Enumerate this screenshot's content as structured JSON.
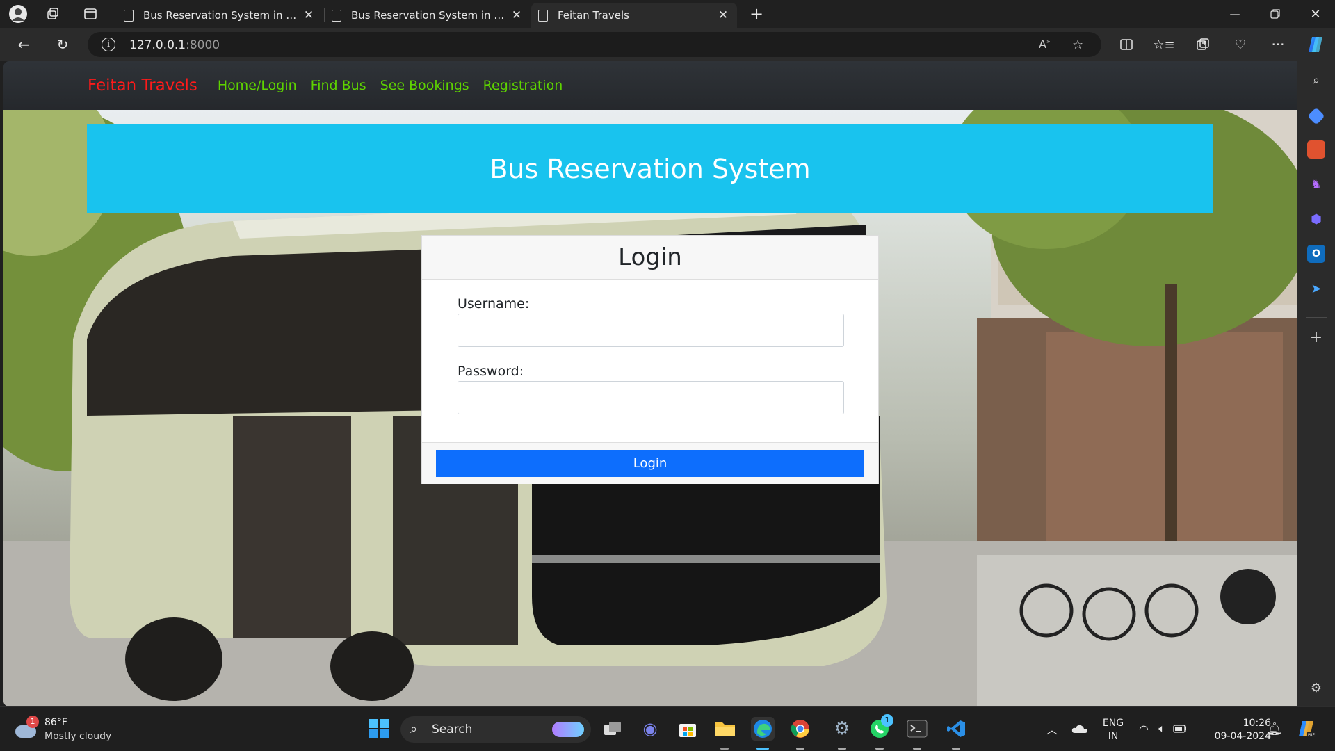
{
  "browser": {
    "tabs": [
      {
        "title": "Bus Reservation System in Djang",
        "active": false
      },
      {
        "title": "Bus Reservation System in Djang",
        "active": false
      },
      {
        "title": "Feitan Travels",
        "active": true
      }
    ],
    "new_tab_icon": "plus-icon",
    "address": {
      "host": "127.0.0.1",
      "port": ":8000"
    }
  },
  "page": {
    "brand": "Feitan Travels",
    "nav": [
      {
        "label": "Home/Login"
      },
      {
        "label": "Find Bus"
      },
      {
        "label": "See Bookings"
      },
      {
        "label": "Registration"
      }
    ],
    "hero_title": "Bus Reservation System",
    "login": {
      "title": "Login",
      "username_label": "Username:",
      "username_value": "",
      "password_label": "Password:",
      "password_value": "",
      "button_label": "Login"
    },
    "colors": {
      "brand": "#ff1a1a",
      "nav_link": "#5ed400",
      "hero": "#19c3ee",
      "button": "#0d6efd"
    }
  },
  "taskbar": {
    "weather": {
      "temp": "86°F",
      "condition": "Mostly cloudy",
      "badge": "1"
    },
    "search_label": "Search",
    "whatsapp_badge": "1",
    "language": {
      "line1": "ENG",
      "line2": "IN"
    },
    "clock": {
      "time": "10:26",
      "date": "09-04-2024"
    }
  }
}
